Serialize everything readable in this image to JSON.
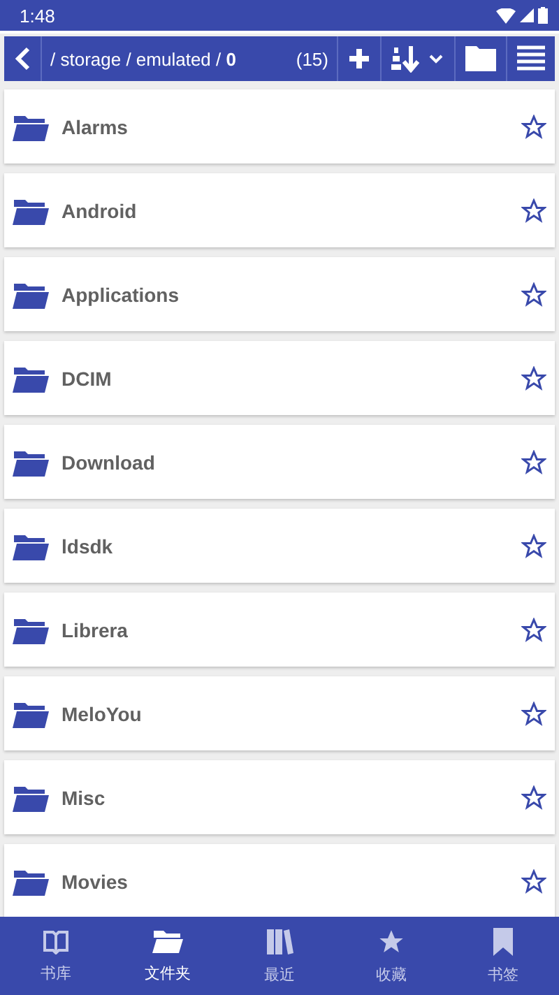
{
  "status_bar": {
    "time": "1:48"
  },
  "toolbar": {
    "path": "/ storage / emulated / **0**",
    "count": "(15)"
  },
  "folders": [
    {
      "name": "Alarms",
      "starred": false
    },
    {
      "name": "Android",
      "starred": false
    },
    {
      "name": "Applications",
      "starred": false
    },
    {
      "name": "DCIM",
      "starred": false
    },
    {
      "name": "Download",
      "starred": false
    },
    {
      "name": "ldsdk",
      "starred": false
    },
    {
      "name": "Librera",
      "starred": false
    },
    {
      "name": "MeloYou",
      "starred": false
    },
    {
      "name": "Misc",
      "starred": false
    },
    {
      "name": "Movies",
      "starred": false
    }
  ],
  "bottom_nav": [
    {
      "kind": "book",
      "label": "书库",
      "selected": false
    },
    {
      "kind": "folder",
      "label": "文件夹",
      "selected": true
    },
    {
      "kind": "shelf",
      "label": "最近",
      "selected": false
    },
    {
      "kind": "star",
      "label": "收藏",
      "selected": false
    },
    {
      "kind": "bookmark",
      "label": "书签",
      "selected": false
    }
  ]
}
